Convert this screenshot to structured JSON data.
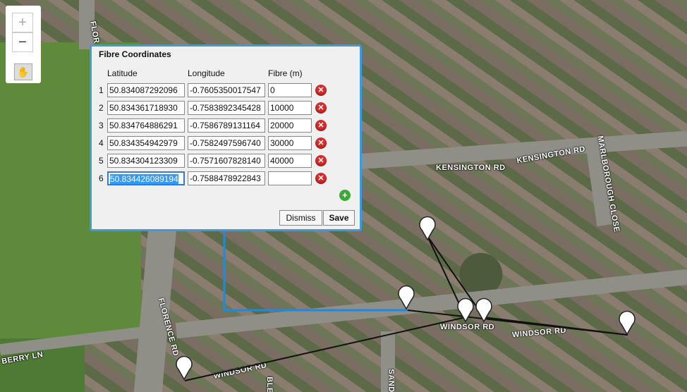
{
  "map": {
    "roads": [
      {
        "id": "kensington-rd",
        "label": "KENSINGTON RD"
      },
      {
        "id": "kensington-rd-2",
        "label": "KENSINGTON RD"
      },
      {
        "id": "marlborough-close",
        "label": "MARLBOROUGH CLOSE"
      },
      {
        "id": "windsor-rd-1",
        "label": "WINDSOR RD"
      },
      {
        "id": "windsor-rd-2",
        "label": "WINDSOR RD"
      },
      {
        "id": "windsor-rd-3",
        "label": "WINDSOR RD"
      },
      {
        "id": "florence-rd",
        "label": "FLORENCE RD"
      },
      {
        "id": "florence-rd-top",
        "label": "FLOR"
      },
      {
        "id": "berry-ln",
        "label": "BERRY LN"
      },
      {
        "id": "sand",
        "label": "SAND"
      },
      {
        "id": "ble",
        "label": "BLE"
      }
    ],
    "route_color": "#1e88e5"
  },
  "controls": {
    "zoom_in": "+",
    "zoom_out": "−",
    "pan_icon": "hand-icon"
  },
  "panel": {
    "title": "Fibre Coordinates",
    "headers": {
      "latitude": "Latitude",
      "longitude": "Longitude",
      "fibre": "Fibre (m)"
    },
    "rows": [
      {
        "n": "1",
        "lat": "50.834087292096",
        "lon": "-0.7605350017547",
        "fibre": "0"
      },
      {
        "n": "2",
        "lat": "50.834361718930",
        "lon": "-0.7583892345428",
        "fibre": "10000"
      },
      {
        "n": "3",
        "lat": "50.834764886291",
        "lon": "-0.7586789131164",
        "fibre": "20000"
      },
      {
        "n": "4",
        "lat": "50.834354942979",
        "lon": "-0.7582497596740",
        "fibre": "30000"
      },
      {
        "n": "5",
        "lat": "50.834304123309",
        "lon": "-0.7571607828140",
        "fibre": "40000"
      },
      {
        "n": "6",
        "lat": "50.834426089194",
        "lon": "-0.7588478922843",
        "fibre": ""
      }
    ],
    "delete_icon": "delete-icon",
    "add_icon": "add-icon",
    "dismiss_label": "Dismiss",
    "save_label": "Save"
  }
}
